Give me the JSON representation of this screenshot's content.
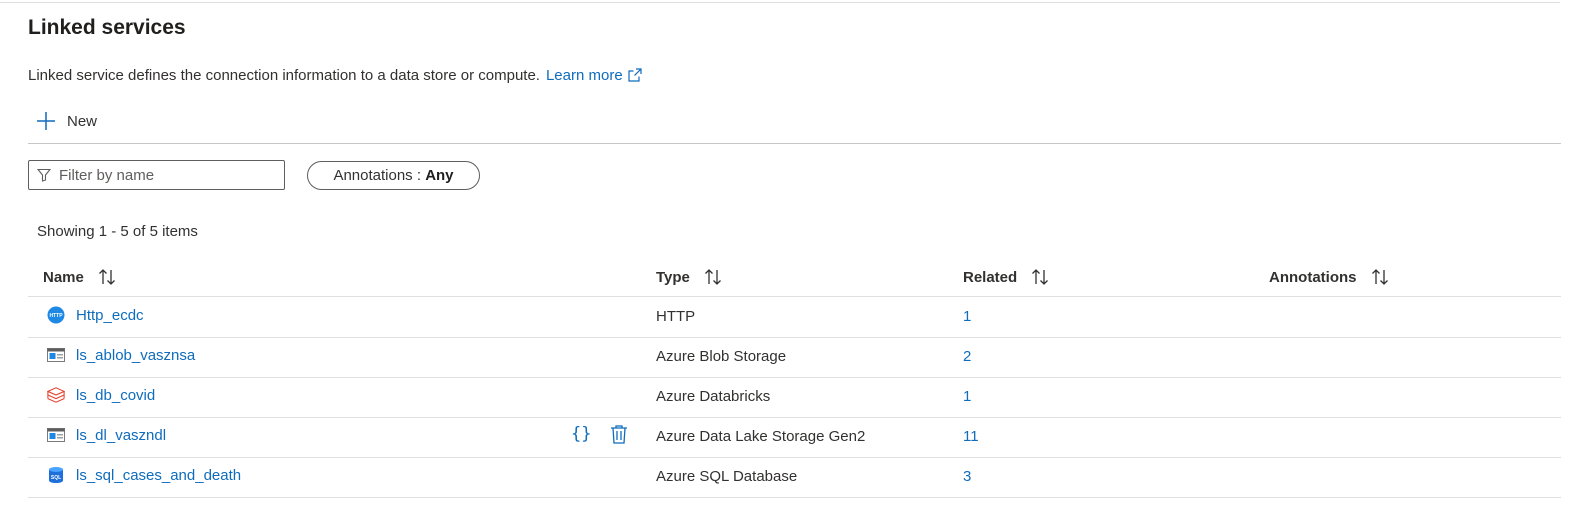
{
  "header": {
    "title": "Linked services",
    "description": "Linked service defines the connection information to a data store or compute.",
    "learn_more": "Learn more"
  },
  "toolbar": {
    "new_label": "New"
  },
  "filter": {
    "placeholder": "Filter by name",
    "value": ""
  },
  "annotations_filter": {
    "label": "Annotations : ",
    "value": "Any"
  },
  "count_text": "Showing 1 - 5 of 5 items",
  "table": {
    "columns": [
      "Name",
      "Type",
      "Related",
      "Annotations"
    ],
    "rows": [
      {
        "name": "Http_ecdc",
        "icon": "http-icon",
        "type": "HTTP",
        "related": "1",
        "annotations": ""
      },
      {
        "name": "ls_ablob_vasznsa",
        "icon": "blob-storage-icon",
        "type": "Azure Blob Storage",
        "related": "2",
        "annotations": ""
      },
      {
        "name": "ls_db_covid",
        "icon": "databricks-icon",
        "type": "Azure Databricks",
        "related": "1",
        "annotations": ""
      },
      {
        "name": "ls_dl_vaszndl",
        "icon": "data-lake-icon",
        "type": "Azure Data Lake Storage Gen2",
        "related": "11",
        "annotations": ""
      },
      {
        "name": "ls_sql_cases_and_death",
        "icon": "sql-database-icon",
        "type": "Azure SQL Database",
        "related": "3",
        "annotations": ""
      }
    ],
    "hover_actions": {
      "json_icon": "braces-icon",
      "delete_icon": "trash-icon"
    }
  },
  "colors": {
    "link": "#0f6cbd",
    "databricks": "#e4432f",
    "http_badge": "#1e88e5"
  }
}
